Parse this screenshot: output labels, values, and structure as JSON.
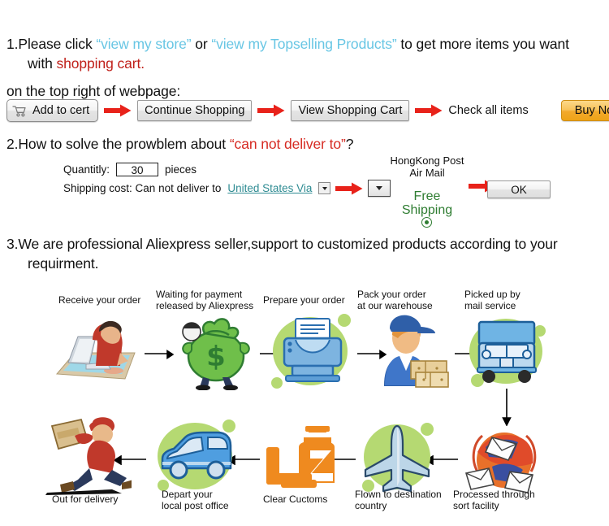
{
  "section1": {
    "line1_a": "1.Please click ",
    "line1_q1": "“view my store”",
    "line1_b": " or ",
    "line1_q2": "“view my Topselling Products”",
    "line1_c": " to get more items you want",
    "line2_a": "with ",
    "line2_red": "shopping cart.",
    "line3": "on the top right of webpage:"
  },
  "buttons": {
    "add_to_cart": "Add to cert",
    "continue_shopping": "Continue Shopping",
    "view_shopping_cart": "View Shopping Cart",
    "check_all_items": "Check all items",
    "buy_now": "Buy Now",
    "ok": "OK",
    "cart_icon": "shopping-cart-icon",
    "arrow_icon": "red-arrow-right-icon"
  },
  "section2": {
    "heading_a": "2.How to solve the prowblem about ",
    "heading_red": "“can not deliver to”",
    "heading_b": "?",
    "quantity_label": "Quantitly:",
    "quantity_value": "30",
    "pieces_label": "pieces",
    "shipping_label": "Shipping cost: Can not deliver to",
    "country_value": "United States Via",
    "post_line1": "HongKong Post",
    "post_line2": "Air Mail",
    "free_line1": "Free",
    "free_line2": "Shipping",
    "dropdown_icon": "chevron-down-icon",
    "radio_icon": "radio-selected-icon"
  },
  "section3": {
    "line1": "3.We are professional Aliexpress seller,support to customized products according to your",
    "line2": "requirment."
  },
  "colors": {
    "blue_link": "#68c6e4",
    "red_text": "#c0201a",
    "green_text": "#2f7d32",
    "arrow_red": "#e8221a",
    "blob_green": "#b5d972",
    "buy_now_orange": "#f2a92c",
    "country_link": "#2f8c93"
  },
  "flow": {
    "top": [
      {
        "label1": "Receive your order",
        "label2": "",
        "icon": "person-at-computer-icon"
      },
      {
        "label1": "Waiting for payment",
        "label2": "released by Aliexpress",
        "icon": "money-bag-icon"
      },
      {
        "label1": "Prepare your order",
        "label2": "",
        "icon": "printer-icon"
      },
      {
        "label1": "Pack your order",
        "label2": "at our warehouse",
        "icon": "worker-with-boxes-icon"
      },
      {
        "label1": "Picked up by",
        "label2": "mail service",
        "icon": "mail-truck-icon"
      }
    ],
    "bottom": [
      {
        "label1": "Out for delivery",
        "label2": "",
        "icon": "courier-running-icon"
      },
      {
        "label1": "Depart your",
        "label2": "local post office",
        "icon": "blue-van-icon"
      },
      {
        "label1": "Clear Cuctoms",
        "label2": "",
        "icon": "customs-officer-icon"
      },
      {
        "label1": "Flown to destination",
        "label2": "country",
        "icon": "airplane-icon"
      },
      {
        "label1": "Processed through",
        "label2": "sort facility",
        "icon": "mail-sorting-globe-icon"
      }
    ]
  }
}
